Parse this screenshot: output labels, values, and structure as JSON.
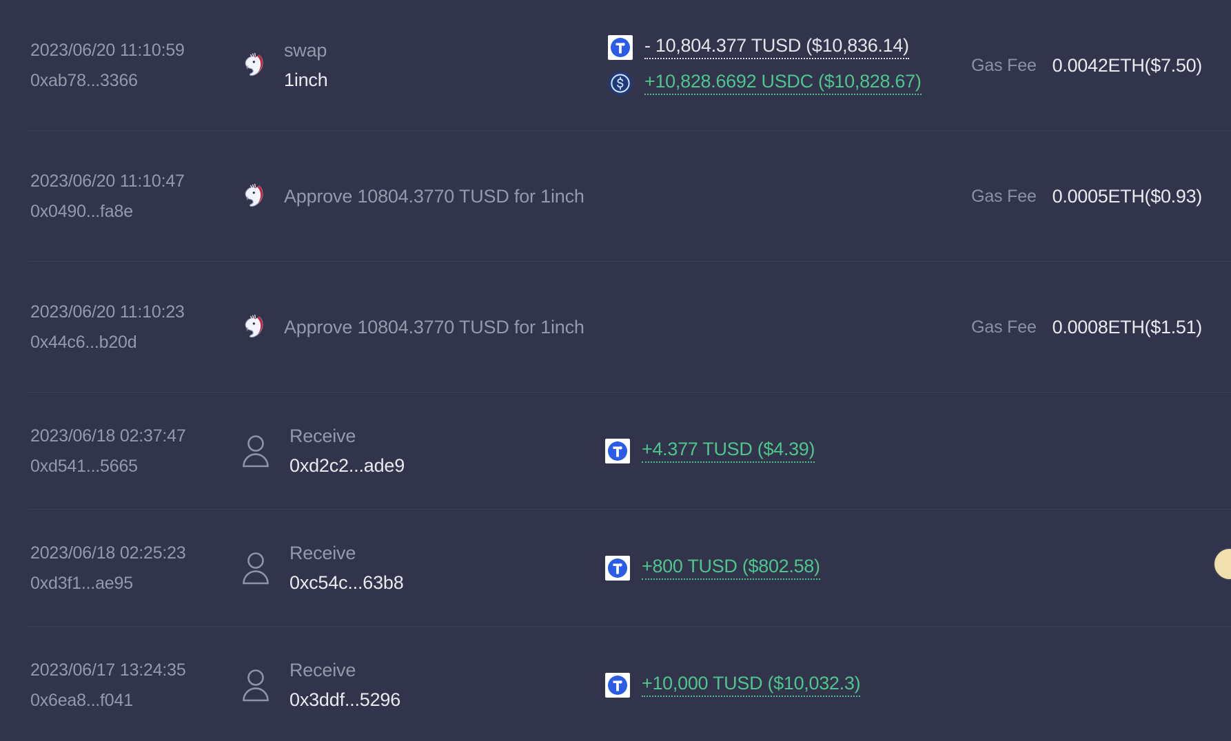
{
  "theme": {
    "background": "#31344a",
    "divider": "#3b3e55",
    "text_muted": "#9599ab",
    "text_primary": "#e9ebf1",
    "positive": "#4fc58d",
    "accent_token_tusd": "#2b5ce6",
    "accent_token_usdc": "#2775ca",
    "edge_widget_color": "#f2dfae"
  },
  "labels": {
    "gas_fee": "Gas Fee"
  },
  "transactions": [
    {
      "time": "2023/06/20 11:10:59",
      "hash": "0xab78...3366",
      "app_icon": "uniswap-unicorn-icon",
      "action_primary": "swap",
      "action_secondary": "1inch",
      "amounts": [
        {
          "icon": "tusd-token-icon",
          "text": "- 10,804.377 TUSD ($10,836.14)",
          "sign": "negative"
        },
        {
          "icon": "usdc-token-icon",
          "text": "+10,828.6692 USDC ($10,828.67)",
          "sign": "positive"
        }
      ],
      "gas_value": "0.0042ETH($7.50)"
    },
    {
      "time": "2023/06/20 11:10:47",
      "hash": "0x0490...fa8e",
      "app_icon": "uniswap-unicorn-icon",
      "action_single": "Approve 10804.3770 TUSD for 1inch",
      "amounts": [],
      "gas_value": "0.0005ETH($0.93)"
    },
    {
      "time": "2023/06/20 11:10:23",
      "hash": "0x44c6...b20d",
      "app_icon": "uniswap-unicorn-icon",
      "action_single": "Approve 10804.3770 TUSD for 1inch",
      "amounts": [],
      "gas_value": "0.0008ETH($1.51)"
    },
    {
      "time": "2023/06/18 02:37:47",
      "hash": "0xd541...5665",
      "app_icon": "person-avatar-icon",
      "action_primary": "Receive",
      "action_secondary": "0xd2c2...ade9",
      "amounts": [
        {
          "icon": "tusd-token-icon",
          "text": "+4.377 TUSD ($4.39)",
          "sign": "positive"
        }
      ],
      "gas_value": ""
    },
    {
      "time": "2023/06/18 02:25:23",
      "hash": "0xd3f1...ae95",
      "app_icon": "person-avatar-icon",
      "action_primary": "Receive",
      "action_secondary": "0xc54c...63b8",
      "amounts": [
        {
          "icon": "tusd-token-icon",
          "text": "+800 TUSD ($802.58)",
          "sign": "positive"
        }
      ],
      "gas_value": ""
    },
    {
      "time": "2023/06/17 13:24:35",
      "hash": "0x6ea8...f041",
      "app_icon": "person-avatar-icon",
      "action_primary": "Receive",
      "action_secondary": "0x3ddf...5296",
      "amounts": [
        {
          "icon": "tusd-token-icon",
          "text": "+10,000 TUSD ($10,032.3)",
          "sign": "positive"
        }
      ],
      "gas_value": ""
    }
  ]
}
